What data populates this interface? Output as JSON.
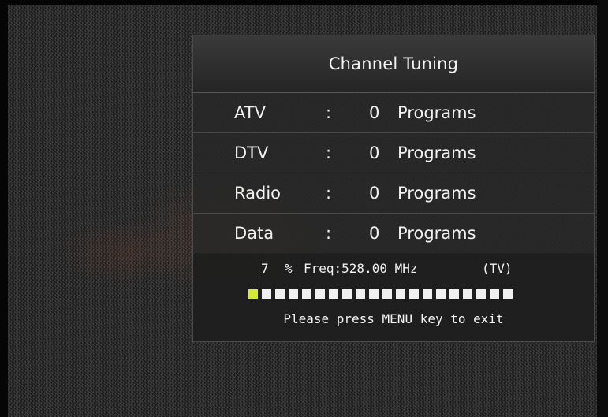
{
  "osd": {
    "title": "Channel Tuning",
    "rows": [
      {
        "label": "ATV",
        "separator": ":",
        "count": "0",
        "unit": "Programs"
      },
      {
        "label": "DTV",
        "separator": ":",
        "count": "0",
        "unit": "Programs"
      },
      {
        "label": "Radio",
        "separator": ":",
        "count": "0",
        "unit": "Programs"
      },
      {
        "label": "Data",
        "separator": ":",
        "count": "0",
        "unit": "Programs"
      }
    ],
    "progress": {
      "percent": "7",
      "percent_sign": "%",
      "frequency": "Freq:528.00 MHz",
      "mode": "(TV)",
      "segments_total": 20,
      "segments_filled": 1,
      "filled_color": "#d6e83a",
      "empty_color": "#f0f0f0"
    },
    "exit_hint": "Please press MENU key to exit"
  }
}
